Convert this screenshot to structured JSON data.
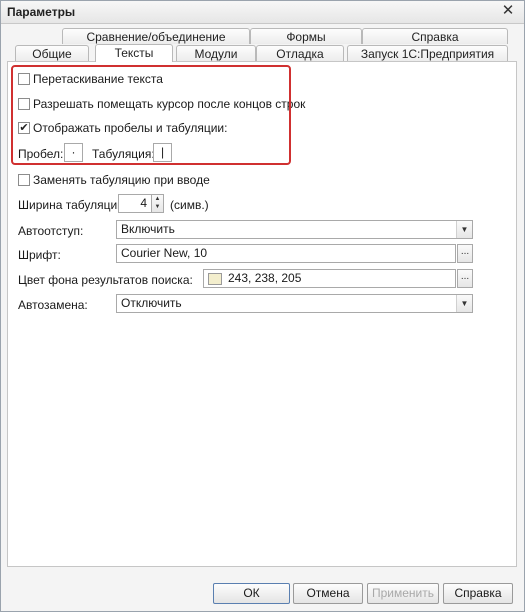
{
  "window": {
    "title": "Параметры"
  },
  "tabs_row1": [
    {
      "label": "Сравнение/объединение"
    },
    {
      "label": "Формы"
    },
    {
      "label": "Справка"
    }
  ],
  "tabs_row2": [
    {
      "label": "Общие"
    },
    {
      "label": "Тексты"
    },
    {
      "label": "Модули"
    },
    {
      "label": "Отладка"
    },
    {
      "label": "Запуск 1С:Предприятия"
    }
  ],
  "active_tab": "Тексты",
  "options": {
    "drag_text": {
      "label": "Перетаскивание текста",
      "checked": false
    },
    "allow_cursor": {
      "label": "Разрешать помещать курсор после концов строк",
      "checked": false
    },
    "show_whitespace": {
      "label": "Отображать пробелы и табуляции:",
      "checked": true,
      "mark": "✔"
    },
    "space_label": "Пробел:",
    "space_value": "·",
    "tab_label": "Табуляция:",
    "tab_value": "|",
    "replace_tabs": {
      "label": "Заменять табуляцию при вводе",
      "checked": false
    }
  },
  "tab_width": {
    "label": "Ширина табуляции:",
    "value": "4",
    "unit": "(симв.)"
  },
  "autoindent": {
    "label": "Автоотступ:",
    "value": "Включить"
  },
  "font": {
    "label": "Шрифт:",
    "value": "Courier New, 10"
  },
  "search_bg": {
    "label": "Цвет фона результатов поиска:",
    "value": "243, 238, 205",
    "color": "#f3eecd"
  },
  "autoreplace": {
    "label": "Автозамена:",
    "value": "Отключить"
  },
  "buttons": {
    "ok": "ОК",
    "cancel": "Отмена",
    "apply": "Применить",
    "help": "Справка"
  },
  "icons": {
    "close": "✕",
    "dropdown": "▼",
    "select": "...",
    "spin_up": "▲",
    "spin_down": "▼"
  }
}
